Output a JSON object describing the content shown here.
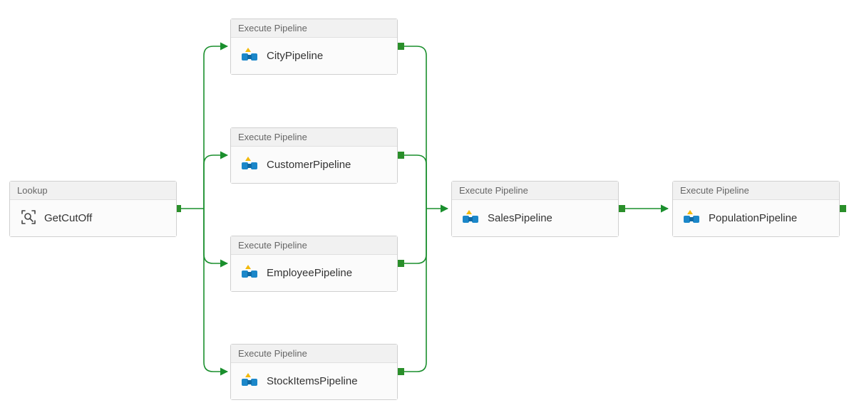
{
  "activities": {
    "getcutoff": {
      "type_label": "Lookup",
      "name": "GetCutOff"
    },
    "city": {
      "type_label": "Execute Pipeline",
      "name": "CityPipeline"
    },
    "customer": {
      "type_label": "Execute Pipeline",
      "name": "CustomerPipeline"
    },
    "employee": {
      "type_label": "Execute Pipeline",
      "name": "EmployeePipeline"
    },
    "stockitems": {
      "type_label": "Execute Pipeline",
      "name": "StockItemsPipeline"
    },
    "sales": {
      "type_label": "Execute Pipeline",
      "name": "SalesPipeline"
    },
    "population": {
      "type_label": "Execute Pipeline",
      "name": "PopulationPipeline"
    }
  },
  "colors": {
    "connector_green": "#1a8f2d",
    "port_green": "#2a8f2a"
  }
}
